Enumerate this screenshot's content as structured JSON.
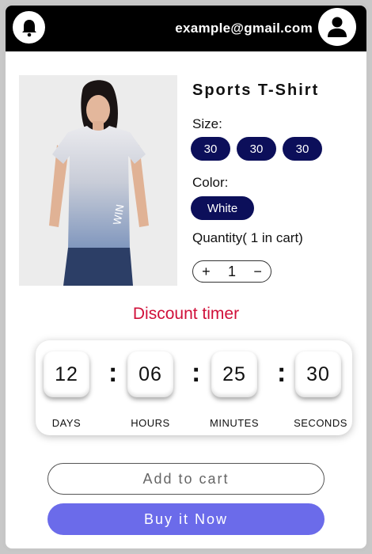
{
  "header": {
    "email": "example@gmail.com",
    "notification_icon": "bell-icon",
    "profile_icon": "user-icon"
  },
  "product": {
    "title": "Sports T-Shirt",
    "size_label": "Size:",
    "sizes": [
      "30",
      "30",
      "30"
    ],
    "color_label": "Color:",
    "color_value": "White",
    "quantity_label": "Quantity( 1 in cart)",
    "quantity": "1",
    "plus": "+",
    "minus": "−"
  },
  "timer": {
    "title": "Discount timer",
    "days": "12",
    "hours": "06",
    "minutes": "25",
    "seconds": "30",
    "days_label": "DAYS",
    "hours_label": "HOURS",
    "minutes_label": "MINUTES",
    "seconds_label": "SECONDS",
    "separator": ":"
  },
  "actions": {
    "add_to_cart": "Add to cart",
    "buy_now": "Buy it Now"
  },
  "colors": {
    "chip": "#0c0f5a",
    "timer_title": "#d0103a",
    "primary_button": "#6b6bea",
    "header": "#000000"
  }
}
